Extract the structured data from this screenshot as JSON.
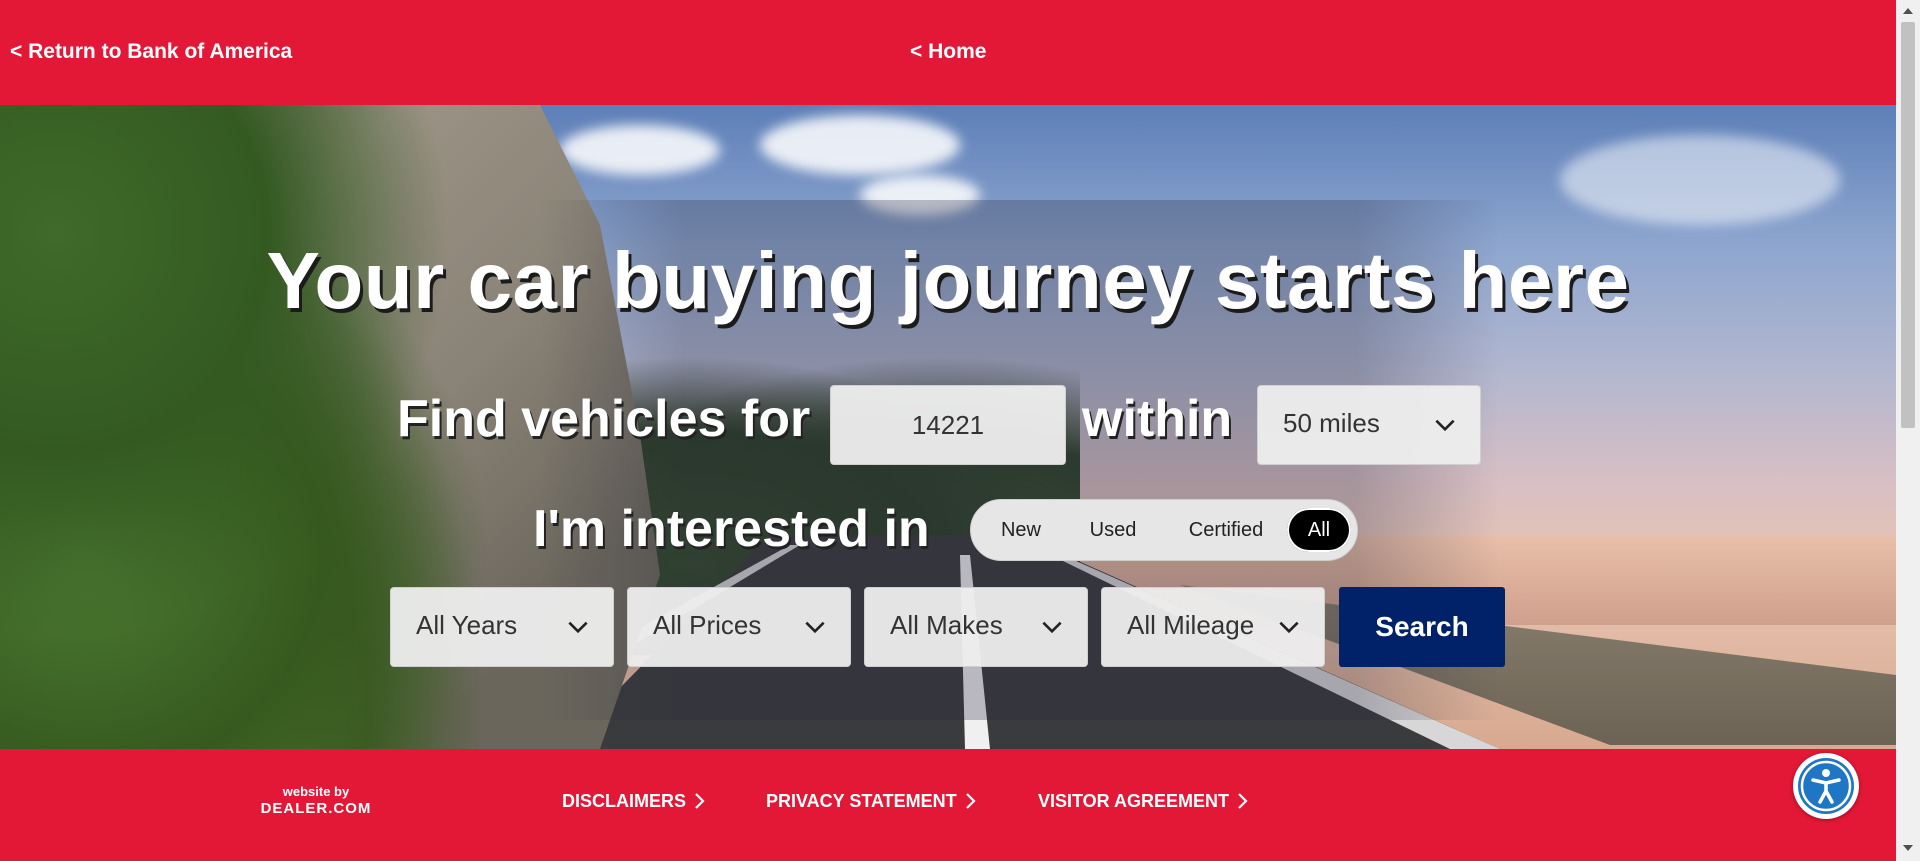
{
  "header": {
    "return_label": "< Return to Bank of America",
    "home_label": "< Home"
  },
  "hero": {
    "headline": "Your car buying journey starts here",
    "find_prefix": "Find vehicles for",
    "zip_value": "14221",
    "within_label": "within",
    "distance_selected": "50 miles",
    "interested_label": "I'm interested in",
    "condition_options": [
      "New",
      "Used",
      "Certified",
      "All"
    ],
    "condition_selected": "All",
    "filters": {
      "years": "All Years",
      "prices": "All Prices",
      "makes": "All Makes",
      "mileage": "All Mileage"
    },
    "search_label": "Search"
  },
  "footer": {
    "logo_by": "website by",
    "logo_brand": "DEALER.COM",
    "links": [
      "DISCLAIMERS",
      "PRIVACY STATEMENT",
      "VISITOR AGREEMENT"
    ]
  },
  "colors": {
    "brand_red": "#e31837",
    "search_navy": "#012169",
    "accessibility_blue": "#1f76c4"
  },
  "icons": {
    "dropdown": "chevron-down-icon",
    "footer_link": "chevron-right-icon",
    "accessibility": "accessibility-icon"
  }
}
